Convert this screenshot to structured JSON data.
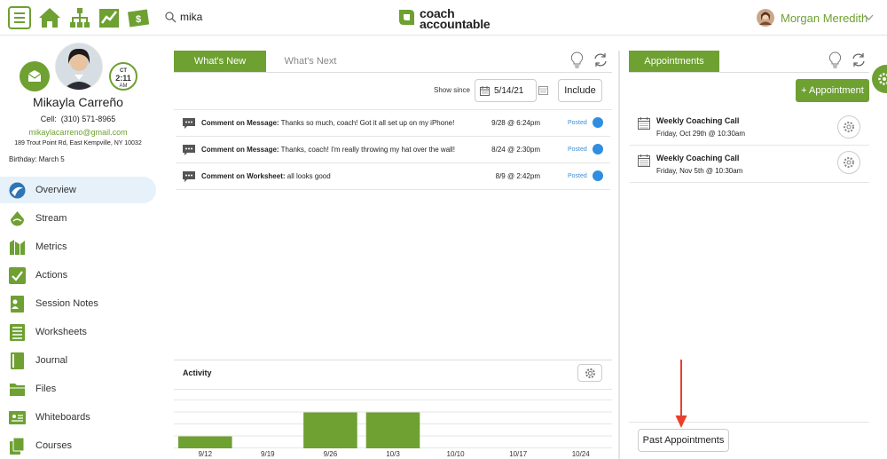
{
  "header": {
    "search_value": "mika",
    "logo_line1": "coach",
    "logo_line2": "accountable",
    "user_name": "Morgan Meredith"
  },
  "client": {
    "timezone": "CT",
    "time": "2:11",
    "ampm": "AM",
    "name": "Mikayla Carreño",
    "cell_label": "Cell:",
    "cell": "(310) 571-8965",
    "email": "mikaylacarreno@gmail.com",
    "address": "189 Trout Point Rd, East Kempville, NY 10032",
    "birthday": "Birthday: March 5"
  },
  "sidebar": {
    "items": [
      {
        "label": "Overview",
        "icon": "overview-icon"
      },
      {
        "label": "Stream",
        "icon": "stream-icon"
      },
      {
        "label": "Metrics",
        "icon": "metrics-icon"
      },
      {
        "label": "Actions",
        "icon": "checkmark-icon"
      },
      {
        "label": "Session Notes",
        "icon": "session-notes-icon"
      },
      {
        "label": "Worksheets",
        "icon": "worksheets-icon"
      },
      {
        "label": "Journal",
        "icon": "journal-icon"
      },
      {
        "label": "Files",
        "icon": "folder-icon"
      },
      {
        "label": "Whiteboards",
        "icon": "whiteboard-icon"
      },
      {
        "label": "Courses",
        "icon": "courses-icon"
      }
    ]
  },
  "whats_new": {
    "tab_active": "What's New",
    "tab_inactive": "What's Next",
    "show_since_label": "Show since",
    "show_since_value": "5/14/21",
    "include_label": "Include",
    "rows": [
      {
        "type": "Comment on Message:",
        "text": "Thanks so much, coach! Got it all set up on my iPhone!",
        "date": "9/28 @ 6:24pm",
        "status": "Posted"
      },
      {
        "type": "Comment on Message:",
        "text": "Thanks, coach! I'm really throwing my hat over the wall!",
        "date": "8/24 @ 2:30pm",
        "status": "Posted"
      },
      {
        "type": "Comment on Worksheet:",
        "text": "all looks good",
        "date": "8/9 @ 2:42pm",
        "status": "Posted"
      }
    ]
  },
  "activity": {
    "title": "Activity"
  },
  "chart_data": {
    "type": "bar",
    "categories": [
      "9/12",
      "9/19",
      "9/26",
      "10/3",
      "10/10",
      "10/17",
      "10/24"
    ],
    "values": [
      1,
      0,
      3,
      3,
      0,
      0,
      0
    ],
    "ylim": [
      0,
      4
    ],
    "title": "Activity",
    "grid": true,
    "color": "#6ea032"
  },
  "appointments": {
    "tab_label": "Appointments",
    "add_label": "+ Appointment",
    "items": [
      {
        "title": "Weekly Coaching Call",
        "when": "Friday, Oct 29th @ 10:30am"
      },
      {
        "title": "Weekly Coaching Call",
        "when": "Friday, Nov 5th @ 10:30am"
      }
    ],
    "past_label": "Past Appointments"
  },
  "colors": {
    "brand_green": "#6ea032",
    "posted_blue": "#2f8ee0",
    "annotation_red": "#e8402c"
  }
}
